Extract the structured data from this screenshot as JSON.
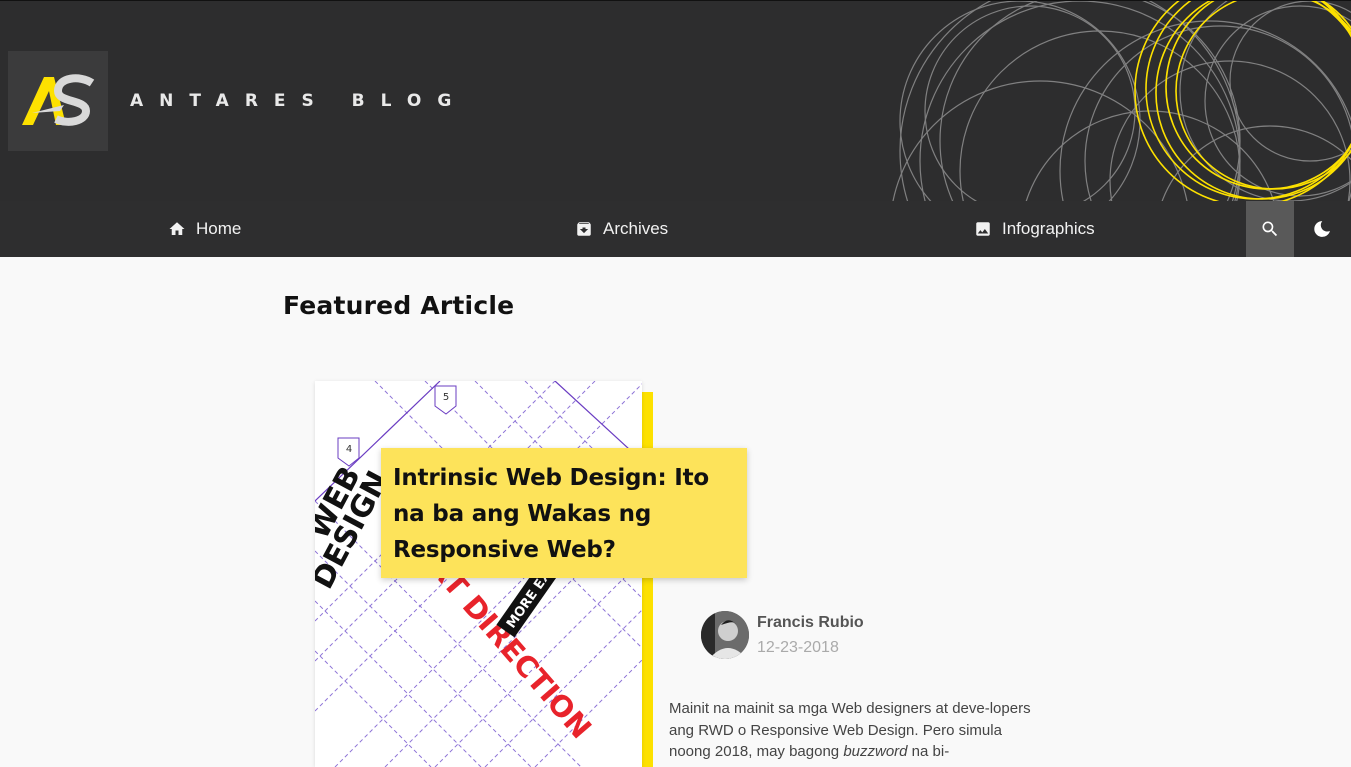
{
  "site": {
    "logo_text": "AS",
    "title": "ANTARES BLOG",
    "colors": {
      "accent": "#fde100",
      "header_bg": "#2d2d2e",
      "card": "#fde35a"
    }
  },
  "nav": {
    "items": [
      {
        "label": "Home",
        "icon": "home-icon"
      },
      {
        "label": "Archives",
        "icon": "archive-icon"
      },
      {
        "label": "Infographics",
        "icon": "image-icon"
      }
    ],
    "search_icon": "search-icon",
    "theme_icon": "moon-icon"
  },
  "featured": {
    "section_title": "Featured Article",
    "headline": "Intrinsic Web Design: Ito na ba ang Wakas ng Responsive Web?",
    "cover_labels": {
      "step_4": "4",
      "step_5": "5",
      "word_web": "WEB",
      "word_design": "DESIGN",
      "word_art": "ART DIRECTION",
      "word_more": "MORE EX"
    },
    "author": {
      "name": "Francis Rubio",
      "date": "12-23-2018"
    },
    "excerpt": {
      "part1": "Mainit na mainit sa mga Web designers at deve-lopers ang RWD o Responsive Web Design. Pero simula noong 2018, may bagong ",
      "emphasis": "buzzword",
      "part2": " na bi-"
    }
  }
}
